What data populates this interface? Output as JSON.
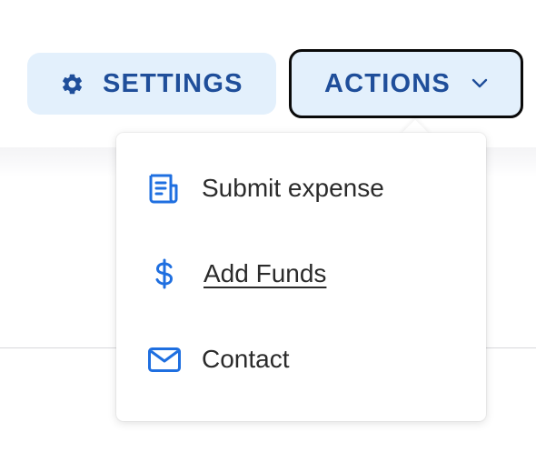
{
  "toolbar": {
    "settings_label": "SETTINGS",
    "actions_label": "ACTIONS"
  },
  "actions_menu": {
    "items": [
      {
        "label": "Submit expense",
        "icon": "receipt-icon"
      },
      {
        "label": "Add Funds",
        "icon": "dollar-icon"
      },
      {
        "label": "Contact",
        "icon": "mail-icon"
      }
    ]
  },
  "colors": {
    "accent": "#1f6fe0",
    "button_bg": "#e3f0fc",
    "button_text": "#1f4e9a",
    "menu_text": "#2b2b2b"
  }
}
